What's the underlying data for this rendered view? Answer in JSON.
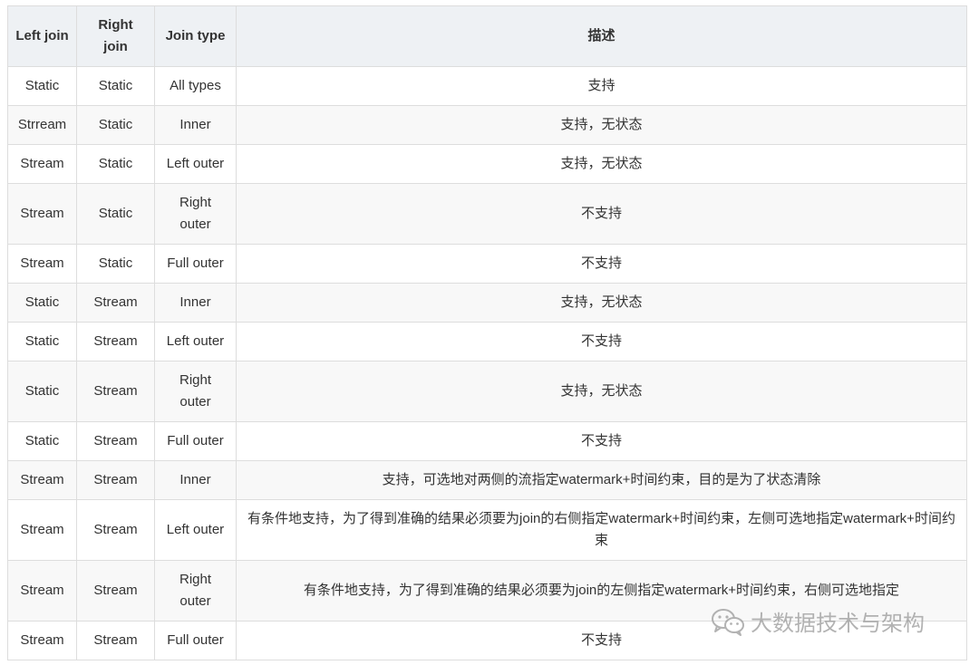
{
  "table": {
    "headers": [
      "Left join",
      "Right join",
      "Join type",
      "描述"
    ],
    "rows": [
      [
        "Static",
        "Static",
        "All types",
        "支持"
      ],
      [
        "Strream",
        "Static",
        "Inner",
        "支持，无状态"
      ],
      [
        "Stream",
        "Static",
        "Left outer",
        "支持，无状态"
      ],
      [
        "Stream",
        "Static",
        "Right outer",
        "不支持"
      ],
      [
        "Stream",
        "Static",
        "Full outer",
        "不支持"
      ],
      [
        "Static",
        "Stream",
        "Inner",
        "支持，无状态"
      ],
      [
        "Static",
        "Stream",
        "Left outer",
        "不支持"
      ],
      [
        "Static",
        "Stream",
        "Right outer",
        "支持，无状态"
      ],
      [
        "Static",
        "Stream",
        "Full outer",
        "不支持"
      ],
      [
        "Stream",
        "Stream",
        "Inner",
        "支持，可选地对两侧的流指定watermark+时间约束，目的是为了状态清除"
      ],
      [
        "Stream",
        "Stream",
        "Left outer",
        "有条件地支持，为了得到准确的结果必须要为join的右侧指定watermark+时间约束，左侧可选地指定watermark+时间约束"
      ],
      [
        "Stream",
        "Stream",
        "Right outer",
        "有条件地支持，为了得到准确的结果必须要为join的左侧指定watermark+时间约束，右侧可选地指定"
      ],
      [
        "Stream",
        "Stream",
        "Full outer",
        "不支持"
      ]
    ]
  },
  "watermark": {
    "text": "大数据技术与架构",
    "icon": "wechat-icon"
  }
}
